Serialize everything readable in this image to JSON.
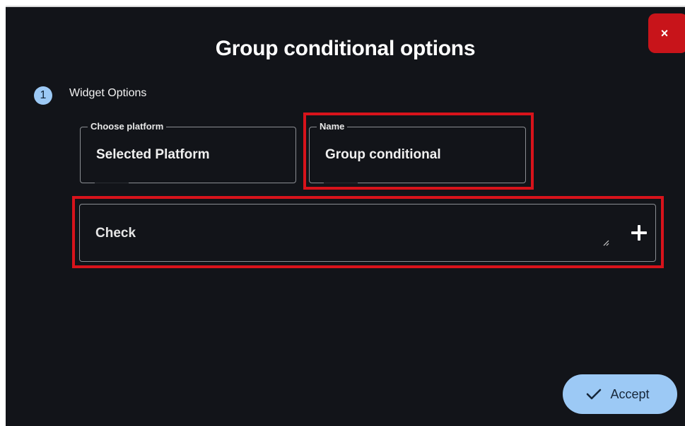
{
  "dialog": {
    "title": "Group conditional options",
    "close_label": "×",
    "step": {
      "number": "1",
      "label": "Widget Options"
    },
    "platform_field": {
      "label": "Choose platform",
      "value": "Selected Platform"
    },
    "name_field": {
      "label": "Name",
      "value": "Group conditional"
    },
    "check_field": {
      "value": "Check"
    },
    "accept_label": "Accept"
  },
  "icons": {
    "close": "close-icon",
    "add": "plus-icon",
    "accept": "check-icon",
    "resize": "resize-handle-icon"
  },
  "colors": {
    "background": "#121419",
    "accent": "#9cc9f5",
    "close_button": "#c8141a",
    "highlight": "#d8131b",
    "field_border": "#8b8e93"
  }
}
